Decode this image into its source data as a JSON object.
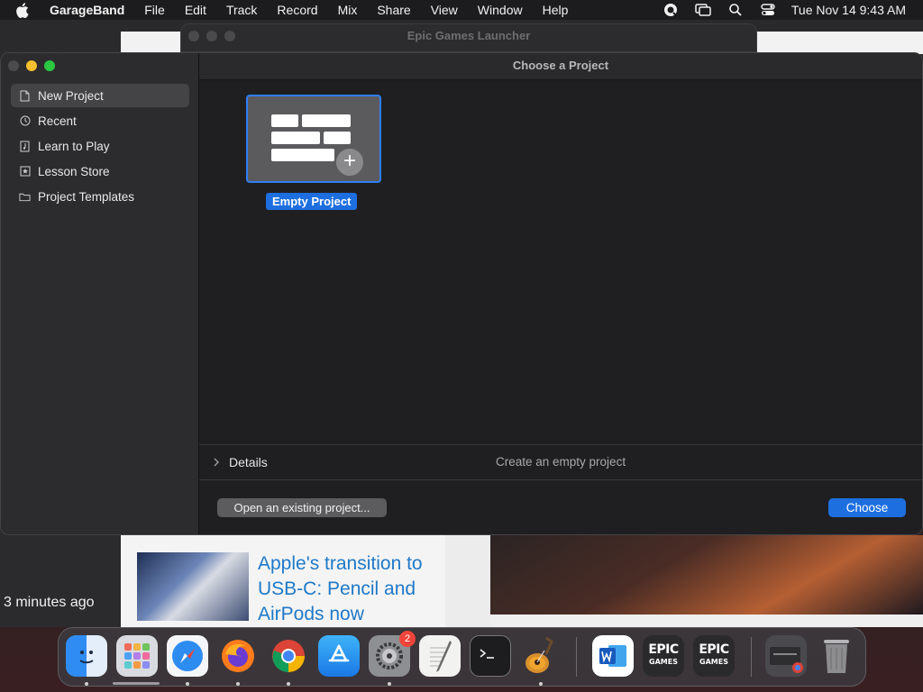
{
  "menubar": {
    "app_name": "GarageBand",
    "items": [
      "File",
      "Edit",
      "Track",
      "Record",
      "Mix",
      "Share",
      "View",
      "Window",
      "Help"
    ],
    "clock": "Tue Nov 14  9:43 AM"
  },
  "background": {
    "epic_window_title": "Epic Games Launcher",
    "time_ago": "3 minutes ago",
    "news_headline": "Apple's transition to USB-C: Pencil and AirPods now"
  },
  "window": {
    "title": "Choose a Project",
    "sidebar": {
      "items": [
        {
          "label": "New Project",
          "icon": "document-icon",
          "selected": true
        },
        {
          "label": "Recent",
          "icon": "clock-icon",
          "selected": false
        },
        {
          "label": "Learn to Play",
          "icon": "music-book-icon",
          "selected": false
        },
        {
          "label": "Lesson Store",
          "icon": "star-box-icon",
          "selected": false
        },
        {
          "label": "Project Templates",
          "icon": "folder-icon",
          "selected": false
        }
      ]
    },
    "project": {
      "label": "Empty Project"
    },
    "details": {
      "label": "Details",
      "description": "Create an empty project"
    },
    "buttons": {
      "open_existing": "Open an existing project...",
      "choose": "Choose"
    }
  },
  "dock": {
    "apps": [
      {
        "name": "Finder",
        "running": true
      },
      {
        "name": "Launchpad",
        "running": false
      },
      {
        "name": "Safari",
        "running": true
      },
      {
        "name": "Firefox",
        "running": true
      },
      {
        "name": "Chrome",
        "running": true
      },
      {
        "name": "App Store",
        "running": false
      },
      {
        "name": "System Settings",
        "running": true,
        "badge": "2"
      },
      {
        "name": "TextEdit",
        "running": false
      },
      {
        "name": "Terminal",
        "running": false
      },
      {
        "name": "GarageBand",
        "running": true
      },
      {
        "name": "Microsoft Word",
        "running": false
      },
      {
        "name": "Epic Games",
        "running": false,
        "text_big": "EPIC",
        "text_small": "GAMES"
      },
      {
        "name": "Epic Games",
        "running": false,
        "text_big": "EPIC",
        "text_small": "GAMES"
      },
      {
        "name": "Downloads",
        "running": false
      },
      {
        "name": "Trash",
        "running": false
      }
    ]
  },
  "colors": {
    "accent": "#1d6fe0",
    "selection_border": "#2f7ff5",
    "traffic_minimize": "#f5bf2e",
    "traffic_zoom": "#2ac840",
    "badge": "#f0443a"
  }
}
